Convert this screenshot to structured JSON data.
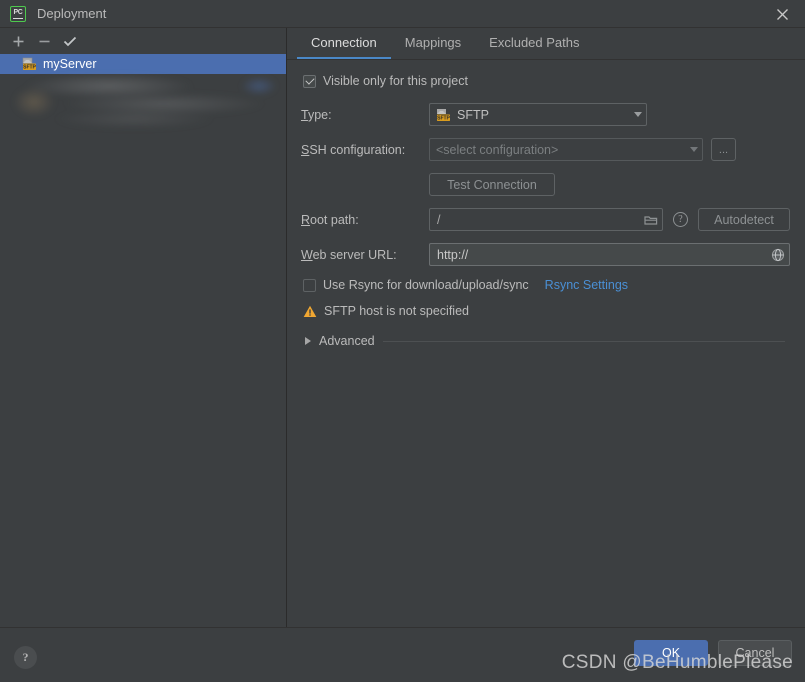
{
  "window": {
    "title": "Deployment",
    "app_icon": "pycharm-icon",
    "icon_text": "PC",
    "close_label": "×"
  },
  "sidebar": {
    "toolbar": [
      {
        "name": "add-server-button",
        "icon": "plus-icon",
        "label": "+"
      },
      {
        "name": "remove-server-button",
        "icon": "minus-icon",
        "label": "−"
      },
      {
        "name": "set-default-button",
        "icon": "check-icon",
        "label": "✓"
      }
    ],
    "items": [
      {
        "label": "myServer",
        "icon": "sftp-server-icon",
        "selected": true
      }
    ]
  },
  "tabs": [
    {
      "label": "Connection",
      "active": true
    },
    {
      "label": "Mappings",
      "active": false
    },
    {
      "label": "Excluded Paths",
      "active": false
    }
  ],
  "form": {
    "visible_only": {
      "label": "Visible only for this project",
      "checked": true
    },
    "type": {
      "label": "Type:",
      "mnemonic": "T",
      "value": "SFTP",
      "icon": "sftp-icon"
    },
    "ssh_configuration": {
      "label": "SSH configuration:",
      "mnemonic": "S",
      "value": "<select configuration>",
      "browse_label": "...",
      "disabled": true
    },
    "test_connection": {
      "label": "Test Connection",
      "disabled": true
    },
    "root_path": {
      "label": "Root path:",
      "mnemonic": "R",
      "value": "/",
      "folder_icon": "folder-icon",
      "help_icon": "question-icon",
      "autodetect_label": "Autodetect"
    },
    "web_server_url": {
      "label": "Web server URL:",
      "mnemonic": "W",
      "value": "http://",
      "globe_icon": "globe-icon"
    },
    "rsync": {
      "label": "Use Rsync for download/upload/sync",
      "checked": false,
      "settings_link": "Rsync Settings"
    },
    "warning": {
      "icon": "warning-triangle-icon",
      "text": "SFTP host is not specified"
    },
    "advanced": {
      "label": "Advanced",
      "expanded": false
    }
  },
  "footer": {
    "help_label": "?",
    "ok_label": "OK",
    "cancel_label": "Cancel"
  },
  "watermark": "CSDN @BeHumblePlease",
  "colors": {
    "background": "#3c3f41",
    "selection": "#4b6eaf",
    "accent_tab": "#4a88c7",
    "link": "#4a8fd4",
    "warning": "#f0a732",
    "icon_green": "#4ec94e"
  }
}
